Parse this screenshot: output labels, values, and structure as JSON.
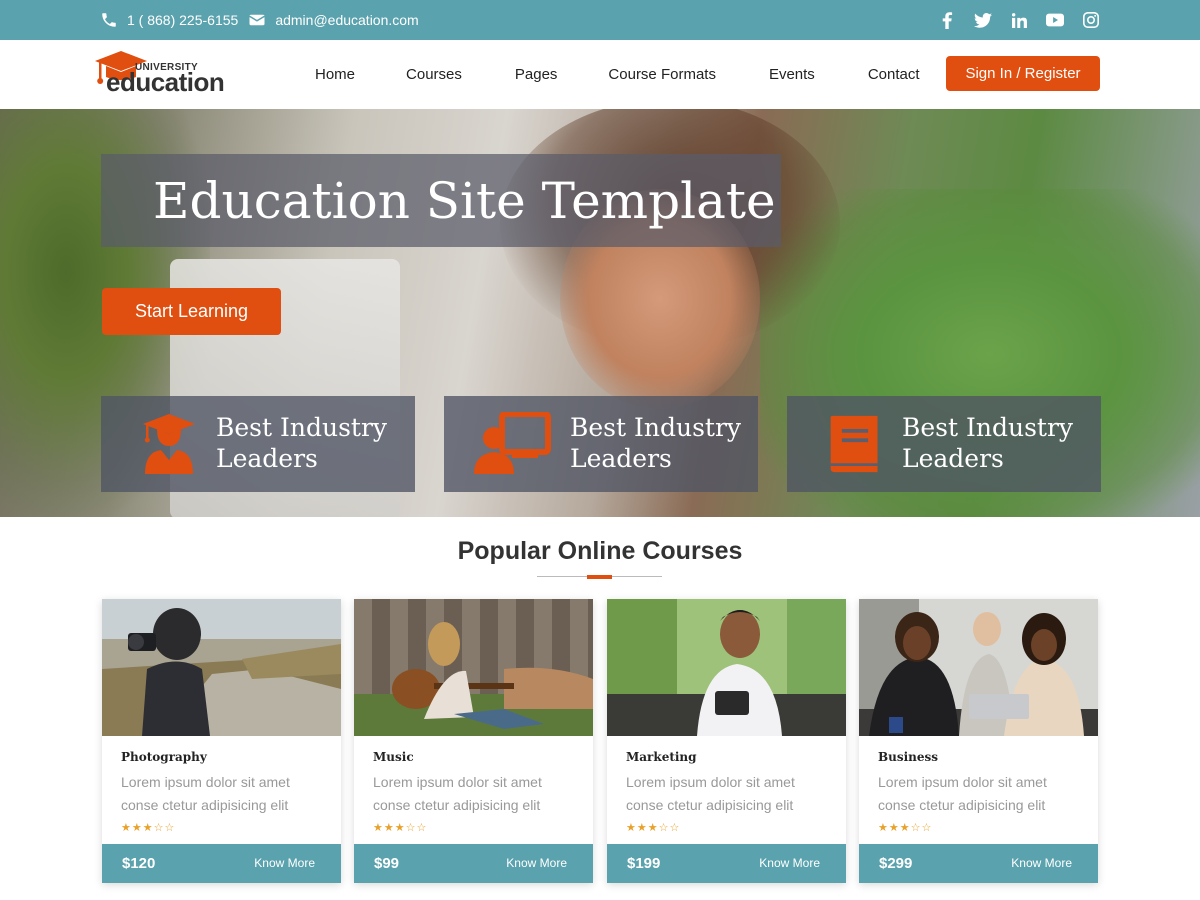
{
  "topbar": {
    "phone": "1 ( 868) 225-6155",
    "email": "admin@education.com",
    "social": [
      "facebook-icon",
      "twitter-icon",
      "linkedin-icon",
      "youtube-icon",
      "instagram-icon"
    ]
  },
  "logo": {
    "small": "UNIVERSITY",
    "big": "education"
  },
  "nav": {
    "items": [
      "Home",
      "Courses",
      "Pages",
      "Course Formats",
      "Events",
      "Contact"
    ],
    "cta": "Sign In / Register"
  },
  "hero": {
    "title": "Education Site Template",
    "button": "Start Learning",
    "features": [
      {
        "line1": "Best Industry",
        "line2": "Leaders",
        "icon": "graduate-icon"
      },
      {
        "line1": "Best Industry",
        "line2": "Leaders",
        "icon": "teacher-board-icon"
      },
      {
        "line1": "Best Industry",
        "line2": "Leaders",
        "icon": "book-icon"
      }
    ]
  },
  "courses": {
    "title": "Popular Online Courses",
    "items": [
      {
        "name": "Photography",
        "desc1": "Lorem ipsum dolor sit amet",
        "desc2": "conse ctetur adipisicing elit",
        "stars": "★★★☆☆",
        "rating": 3,
        "price": "$120",
        "more": "Know More"
      },
      {
        "name": "Music",
        "desc1": "Lorem ipsum dolor sit amet",
        "desc2": "conse ctetur adipisicing elit",
        "stars": "★★★☆☆",
        "rating": 3,
        "price": "$99",
        "more": "Know More"
      },
      {
        "name": "Marketing",
        "desc1": "Lorem ipsum dolor sit amet",
        "desc2": "conse ctetur adipisicing elit",
        "stars": "★★★☆☆",
        "rating": 3,
        "price": "$199",
        "more": "Know More"
      },
      {
        "name": "Business",
        "desc1": "Lorem ipsum dolor sit amet",
        "desc2": "conse ctetur adipisicing elit",
        "stars": "★★★☆☆",
        "rating": 3,
        "price": "$299",
        "more": "Know More"
      }
    ]
  },
  "colors": {
    "teal": "#5aa2ad",
    "accent": "#e04e10",
    "star": "#e8a12a"
  }
}
